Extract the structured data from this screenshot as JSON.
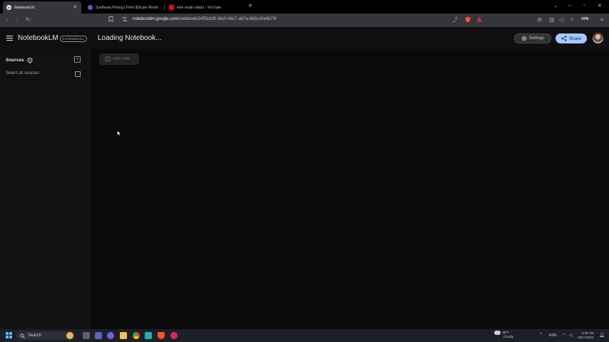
{
  "browser": {
    "tabs": [
      {
        "title": "NotebookLM",
        "active": true
      },
      {
        "title": "Synthesia Pricing | From $18 per Month",
        "active": false
      },
      {
        "title": "elon musk robots - YouTube",
        "active": false
      }
    ],
    "new_tab": "+",
    "url_host": "notebooklm.google.com",
    "url_path": "/notebook/2455cb3f-1bc0-4bc7-ab7a-883cc5a6b7f3",
    "vpn_label": "VPN"
  },
  "header": {
    "brand": "NotebookLM",
    "badge": "EXPERIMENTAL",
    "title": "Loading Notebook...",
    "settings_label": "Settings",
    "share_label": "Share"
  },
  "sidebar": {
    "title": "Sources",
    "select_all": "Select all sources"
  },
  "main": {
    "add_note_label": "Add note"
  },
  "taskbar": {
    "search_placeholder": "Search",
    "weather_temp": "48°F",
    "weather_desc": "Cloudy",
    "language": "ENG",
    "time": "6:30 AM",
    "date": "10/17/2024"
  },
  "colors": {
    "share_button": "#a8c7fa",
    "background": "#0d0d0e",
    "start_accent": "#4cc2ff"
  }
}
